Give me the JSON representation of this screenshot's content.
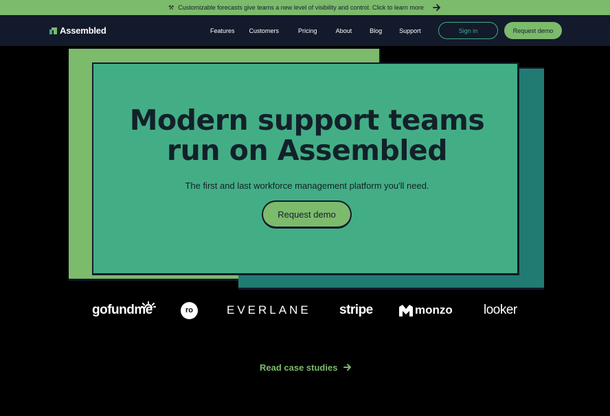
{
  "announcement": {
    "emoji": "⚒",
    "text": "Customizable forecasts give teams a new level of visibility and control. Click to learn more",
    "arrow_icon": "arrow-right-icon"
  },
  "nav": {
    "logo_text": "Assembled",
    "links": [
      "Features",
      "Customers",
      "Pricing",
      "About",
      "Blog",
      "Support"
    ],
    "sign_in": "Sign in",
    "request_demo": "Request demo"
  },
  "hero": {
    "title_line1": "Modern support teams",
    "title_line2": "run on Assembled",
    "subtitle": "The first and last workforce management platform you'll need.",
    "cta": "Request demo"
  },
  "logos": {
    "gofundme": "gofundme",
    "ro": "ro",
    "everlane": "EVERLANE",
    "stripe": "stripe",
    "monzo": "monzo",
    "looker": "looker"
  },
  "case_studies": {
    "label": "Read case studies",
    "icon": "arrow-right-icon"
  },
  "colors": {
    "green": "#7cba6c",
    "teal": "#43ae85",
    "dark_teal": "#227b72",
    "navy": "#131a2b"
  }
}
